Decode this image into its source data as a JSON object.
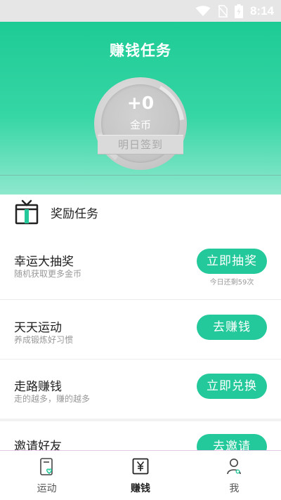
{
  "status_bar": {
    "time": "8:14"
  },
  "header": {
    "title": "赚钱任务",
    "coin_amount": "+0",
    "coin_unit": "金币",
    "checkin_label": "明日签到"
  },
  "section": {
    "title": "奖励任务"
  },
  "tasks": [
    {
      "title": "幸运大抽奖",
      "subtitle": "随机获取更多金币",
      "button": "立即抽奖",
      "note": "今日还剩59次"
    },
    {
      "title": "天天运动",
      "subtitle": "养成锻炼好习惯",
      "button": "去赚钱"
    },
    {
      "title": "走路赚钱",
      "subtitle": "走的越多，赚的越多",
      "button": "立即兑换"
    },
    {
      "title": "邀请好友",
      "button": "去邀请"
    }
  ],
  "nav": [
    {
      "label": "运动",
      "icon": "phone-heart-icon",
      "active": false
    },
    {
      "label": "赚钱",
      "icon": "yuan-card-icon",
      "active": true
    },
    {
      "label": "我",
      "icon": "user-icon",
      "active": false
    }
  ],
  "colors": {
    "accent": "#23c99a",
    "header_top": "#1ecb95",
    "header_bottom": "#8ee8cc"
  }
}
